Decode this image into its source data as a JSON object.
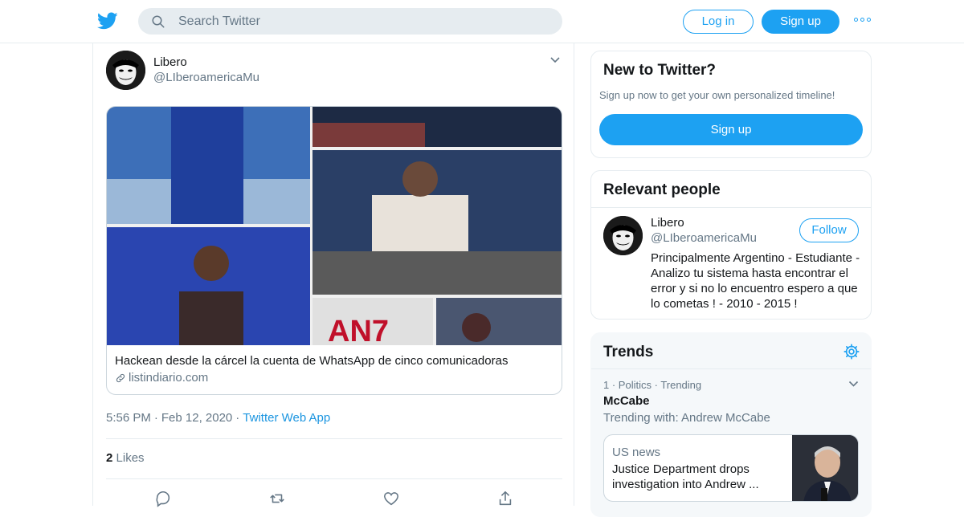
{
  "header": {
    "search_placeholder": "Search Twitter",
    "login_label": "Log in",
    "signup_label": "Sign up",
    "more_icon": "more-dots-icon"
  },
  "tweet": {
    "author_name": "Libero",
    "author_handle": "@LIberoamericaMu",
    "card_title": "Hackean desde la cárcel la cuenta de WhatsApp de cinco comunicadoras",
    "card_domain": "listindiario.com",
    "time": "5:56 PM",
    "date": "Feb 12, 2020",
    "source": "Twitter Web App",
    "likes_count": "2",
    "likes_label": "Likes"
  },
  "new_to_twitter": {
    "title": "New to Twitter?",
    "subtitle": "Sign up now to get your own personalized timeline!",
    "signup_label": "Sign up"
  },
  "relevant_people": {
    "title": "Relevant people",
    "name": "Libero",
    "handle": "@LIberoamericaMu",
    "follow_label": "Follow",
    "bio": "Principalmente Argentino - Estudiante - Analizo tu sistema hasta encontrar el error y si no lo encuentro espero a que lo cometas ! - 2010 - 2015 !"
  },
  "trends": {
    "title": "Trends",
    "item": {
      "rank": "1",
      "category": "Politics",
      "status": "Trending",
      "name": "McCabe",
      "trending_with": "Trending with: Andrew McCabe",
      "news_category": "US news",
      "news_headline": "Justice Department drops investigation into Andrew ..."
    }
  },
  "colors": {
    "accent": "#1da1f2",
    "text": "#14171a",
    "muted": "#657786",
    "border": "#e6ecf0"
  }
}
